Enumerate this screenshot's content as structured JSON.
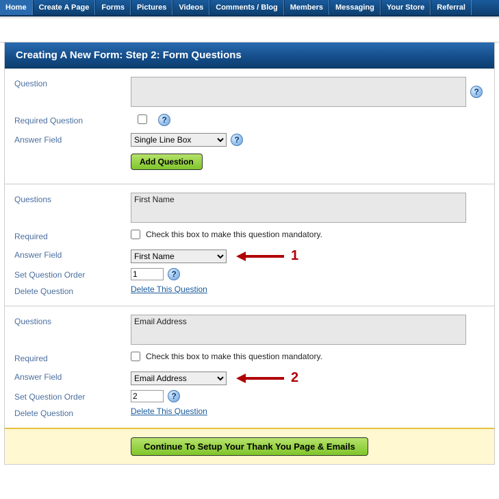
{
  "nav": {
    "items": [
      {
        "label": "Home",
        "active": true
      },
      {
        "label": "Create A Page"
      },
      {
        "label": "Forms"
      },
      {
        "label": "Pictures"
      },
      {
        "label": "Videos"
      },
      {
        "label": "Comments / Blog"
      },
      {
        "label": "Members"
      },
      {
        "label": "Messaging"
      },
      {
        "label": "Your Store"
      },
      {
        "label": "Referral"
      }
    ]
  },
  "header": {
    "title": "Creating A New Form: Step 2: Form Questions"
  },
  "newQuestion": {
    "label_question": "Question",
    "question_value": "",
    "label_required": "Required Question",
    "required_checked": false,
    "label_answerfield": "Answer Field",
    "answerfield_value": "Single Line Box",
    "add_button": "Add Question"
  },
  "questions": [
    {
      "label_questions": "Questions",
      "question_value": "First Name",
      "label_required": "Required",
      "required_checked": false,
      "required_text": "Check this box to make this question mandatory.",
      "label_answerfield": "Answer Field",
      "answerfield_value": "First Name",
      "annotation_num": "1",
      "label_order": "Set Question Order",
      "order_value": "1",
      "label_delete": "Delete Question",
      "delete_link": "Delete This Question"
    },
    {
      "label_questions": "Questions",
      "question_value": "Email Address",
      "label_required": "Required",
      "required_checked": false,
      "required_text": "Check this box to make this question mandatory.",
      "label_answerfield": "Answer Field",
      "answerfield_value": "Email Address",
      "annotation_num": "2",
      "label_order": "Set Question Order",
      "order_value": "2",
      "label_delete": "Delete Question",
      "delete_link": "Delete This Question"
    }
  ],
  "footer": {
    "continue_button": "Continue To Setup Your Thank You Page & Emails"
  },
  "helpGlyph": "?"
}
